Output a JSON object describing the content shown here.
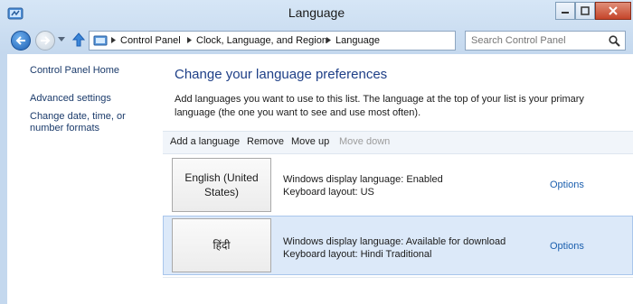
{
  "window": {
    "title": "Language"
  },
  "address": {
    "crumbs": [
      "Control Panel",
      "Clock, Language, and Region",
      "Language"
    ]
  },
  "search": {
    "placeholder": "Search Control Panel"
  },
  "sidebar": {
    "links": [
      "Control Panel Home",
      "Advanced settings",
      "Change date, time, or number formats"
    ]
  },
  "main": {
    "heading": "Change your language preferences",
    "description": "Add languages you want to use to this list. The language at the top of your list is your primary language (the one you want to see and use most often).",
    "toolbar": {
      "add": "Add a language",
      "remove": "Remove",
      "move_up": "Move up",
      "move_down": "Move down"
    },
    "languages": [
      {
        "name": "English (United States)",
        "display": "Windows display language: Enabled",
        "keyboard": "Keyboard layout: US",
        "options": "Options"
      },
      {
        "name": "हिंदी",
        "display": "Windows display language: Available for download",
        "keyboard": "Keyboard layout: Hindi Traditional",
        "options": "Options"
      }
    ]
  },
  "colors": {
    "heading": "#1e3f87",
    "link": "#1b5fae",
    "selected_row": "#dce9f9"
  }
}
